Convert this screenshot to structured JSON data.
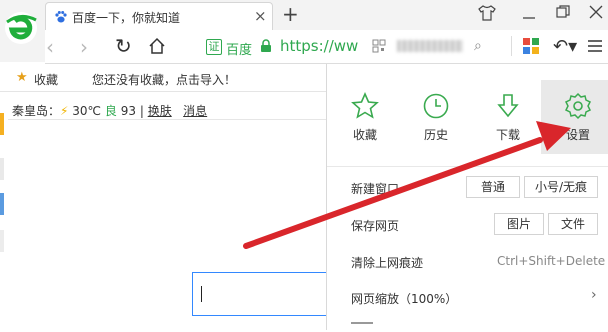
{
  "browser": {
    "tab_title": "百度一下，你就知道",
    "tab_close": "×",
    "new_tab": "+",
    "url_prefix": "https://ww",
    "security_label": "百度",
    "security_badge": "证",
    "back": "‹",
    "forward": "›",
    "reload": "↻",
    "search_glyph": "⌕",
    "undo": "↶▾"
  },
  "bookmarks": {
    "star": "★",
    "label": "收藏",
    "hint": "您还没有收藏，点击导入！"
  },
  "weather": {
    "city": "秦皇岛：",
    "bolt": "⚡",
    "temp": "30℃",
    "aqi_label": "良",
    "aqi_value": "93",
    "divider": "|",
    "skin": "换肤",
    "messages": "消息"
  },
  "menu": {
    "top_items": [
      {
        "label": "收藏",
        "icon": "star-icon"
      },
      {
        "label": "历史",
        "icon": "clock-icon"
      },
      {
        "label": "下载",
        "icon": "download-icon"
      },
      {
        "label": "设置",
        "icon": "gear-icon"
      }
    ],
    "new_window": {
      "label": "新建窗口",
      "normal": "普通",
      "private": "小号/无痕"
    },
    "save_page": {
      "label": "保存网页",
      "image": "图片",
      "file": "文件"
    },
    "clear": {
      "label": "清除上网痕迹",
      "shortcut": "Ctrl+Shift+Delete"
    },
    "zoom": {
      "label": "网页缩放（100%）",
      "arrow": "›"
    }
  },
  "colors": {
    "accent_green": "#2fa84f",
    "arrow_red": "#d9262b",
    "brand_green": "#1fae3b"
  }
}
